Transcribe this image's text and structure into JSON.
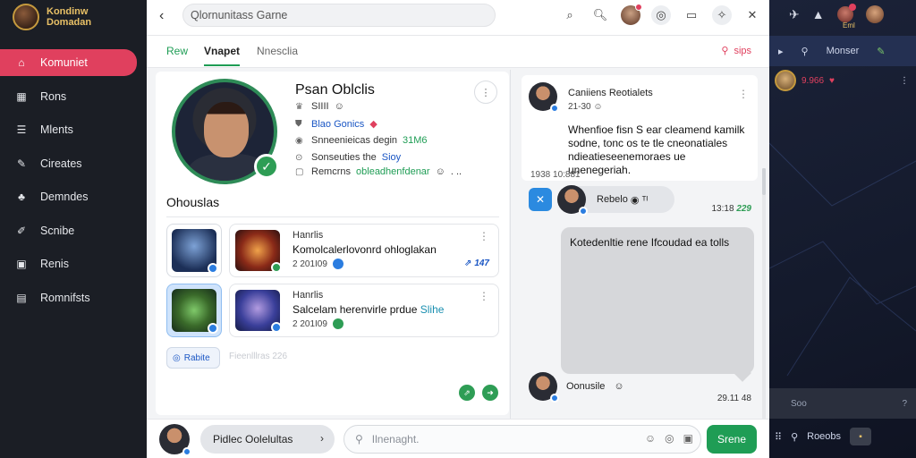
{
  "brand": {
    "line1": "Kondinw",
    "line2": "Domadan"
  },
  "sidebar": {
    "items": [
      {
        "label": "Komuniet",
        "icon": "home-icon",
        "active": true
      },
      {
        "label": "Rons",
        "icon": "store-icon"
      },
      {
        "label": "Mlents",
        "icon": "chat-icon"
      },
      {
        "label": "Cireates",
        "icon": "pen-icon"
      },
      {
        "label": "Demndes",
        "icon": "club-icon"
      },
      {
        "label": "Scnibe",
        "icon": "edit-icon"
      },
      {
        "label": "Renis",
        "icon": "calendar-icon"
      },
      {
        "label": "Romnifsts",
        "icon": "folder-icon"
      }
    ]
  },
  "topbar": {
    "search_value": "Qlornunitass Garne"
  },
  "tabs": {
    "t1": "Rew",
    "t2": "Vnapet",
    "t3": "Nnesclia",
    "right": "sips"
  },
  "profile": {
    "name": "Psan Oblclis",
    "line1": "SIIII",
    "line2": "Blao Gonics",
    "line3a": "Snneenieicas degin",
    "line3b": "31M6",
    "line4a": "Sonseuties the",
    "line4b": "Sioy",
    "line5a": "Remcrns",
    "line5b": "obleadhenfdenar",
    "line5c": ". .."
  },
  "section_title": "Ohouslas",
  "games": [
    {
      "t1": "Hanrlis",
      "t2": "Komolcalerlovonrd ohloglakan",
      "t2_accent": "",
      "t3": "2 201I09",
      "right": "147"
    },
    {
      "t1": "Hanrlis",
      "t2": "Salcelam herenvirle prdue",
      "t2_accent": "Slihe",
      "t3": "2 201I09",
      "right": ""
    }
  ],
  "chip": {
    "label": "Rabite",
    "faint": "Fieenlllras  226"
  },
  "chat": {
    "msg1": {
      "name": "Caniiens Reotialets",
      "sub": "21-30",
      "body": "Whenfioe fisn S ear cleamend kamilk sodne, tonc os te tle cneonatiales ndieatieseenemoraes ue unenegeriah.",
      "time": "1938 ",
      "time_b": "10:881"
    },
    "reply": {
      "label": "Rebelo",
      "time": "13:18",
      "time_green": "229"
    },
    "bubble": "Kotedenltie rene Ifcoudad ea tolls",
    "msg3": {
      "label": "Oonusile",
      "time": "29.11 ",
      "time_b": "48"
    }
  },
  "composer": {
    "selector": "Pidlec Oolelultas",
    "placeholder": "Ilnenaght.",
    "send": "Srene"
  },
  "rightpanel": {
    "label": "Eml",
    "tabs": [
      "Monser"
    ],
    "row3": "9.966 ",
    "bottom_label": "Soo",
    "bottom2": "Roeobs"
  }
}
